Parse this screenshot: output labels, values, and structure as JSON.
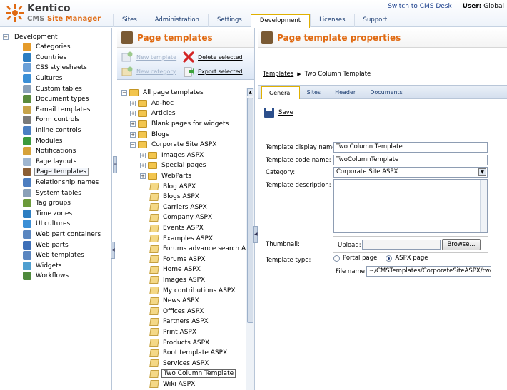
{
  "logo": {
    "brand": "Kentico",
    "product_cms": "CMS",
    "product_rest": "Site Manager"
  },
  "top_links": {
    "switch": "Switch to CMS Desk",
    "user_label": "User:",
    "user_value": "Global"
  },
  "main_tabs": [
    "Sites",
    "Administration",
    "Settings",
    "Development",
    "Licenses",
    "Support"
  ],
  "active_tab": "Development",
  "left_tree": {
    "root": "Development",
    "items": [
      {
        "label": "Categories",
        "icon": "categories-icon",
        "color": "#e59b2a"
      },
      {
        "label": "Countries",
        "icon": "globe-icon",
        "color": "#2d7ec2"
      },
      {
        "label": "CSS stylesheets",
        "icon": "css-icon",
        "color": "#6aa0d8"
      },
      {
        "label": "Cultures",
        "icon": "globe-icon",
        "color": "#3b8fd6"
      },
      {
        "label": "Custom tables",
        "icon": "table-icon",
        "color": "#8aa0b8"
      },
      {
        "label": "Document types",
        "icon": "document-types-icon",
        "color": "#5a8b3c"
      },
      {
        "label": "E-mail templates",
        "icon": "email-icon",
        "color": "#c7a44a"
      },
      {
        "label": "Form controls",
        "icon": "form-controls-icon",
        "color": "#7a7a7a"
      },
      {
        "label": "Inline controls",
        "icon": "inline-controls-icon",
        "color": "#4b7fc2"
      },
      {
        "label": "Modules",
        "icon": "modules-icon",
        "color": "#3c9a3c"
      },
      {
        "label": "Notifications",
        "icon": "notifications-icon",
        "color": "#d6a23a"
      },
      {
        "label": "Page layouts",
        "icon": "page-layouts-icon",
        "color": "#9fb6d0"
      },
      {
        "label": "Page templates",
        "icon": "page-templates-icon",
        "color": "#8b5e34",
        "selected": true
      },
      {
        "label": "Relationship names",
        "icon": "relationship-icon",
        "color": "#4c7dc0"
      },
      {
        "label": "System tables",
        "icon": "system-tables-icon",
        "color": "#8aa0b8"
      },
      {
        "label": "Tag groups",
        "icon": "tag-icon",
        "color": "#6b9a3a"
      },
      {
        "label": "Time zones",
        "icon": "clock-icon",
        "color": "#2d7ec2"
      },
      {
        "label": "UI cultures",
        "icon": "globe-icon",
        "color": "#3b8fd6"
      },
      {
        "label": "Web part containers",
        "icon": "container-icon",
        "color": "#5a86c0"
      },
      {
        "label": "Web parts",
        "icon": "web-parts-icon",
        "color": "#3d6fb8"
      },
      {
        "label": "Web templates",
        "icon": "web-templates-icon",
        "color": "#5a86c0"
      },
      {
        "label": "Widgets",
        "icon": "widgets-icon",
        "color": "#4f9fd0"
      },
      {
        "label": "Workflows",
        "icon": "workflow-icon",
        "color": "#4f8a3c"
      }
    ]
  },
  "middle": {
    "title": "Page templates",
    "actions": {
      "new_template": "New template",
      "new_category": "New category",
      "delete_selected": "Delete selected",
      "export_selected": "Export selected"
    },
    "tree_root": "All page templates",
    "level1": [
      "Ad-hoc",
      "Articles",
      "Blank pages for widgets",
      "Blogs"
    ],
    "open_category": "Corporate Site ASPX",
    "subcategories": [
      "Images ASPX",
      "Special pages",
      "WebParts"
    ],
    "templates": [
      "Blog ASPX",
      "Blogs ASPX",
      "Carriers ASPX",
      "Company ASPX",
      "Events ASPX",
      "Examples ASPX",
      "Forums advance search ASPX",
      "Forums ASPX",
      "Home ASPX",
      "Images ASPX",
      "My contributions ASPX",
      "News ASPX",
      "Offices ASPX",
      "Partners ASPX",
      "Print ASPX",
      "Products ASPX",
      "Root template ASPX",
      "Services ASPX",
      "Two Column Template",
      "Wiki ASPX"
    ],
    "selected_template": "Two Column Template"
  },
  "right": {
    "title": "Page template properties",
    "breadcrumb_link": "Templates",
    "breadcrumb_current": "Two Column Template",
    "subtabs": [
      "General",
      "Sites",
      "Header",
      "Documents"
    ],
    "active_subtab": "General",
    "save_label": "Save",
    "labels": {
      "display_name": "Template display name:",
      "code_name": "Template code name:",
      "category": "Category:",
      "description": "Template description:",
      "thumbnail": "Thumbnail:",
      "template_type": "Template type:",
      "upload": "Upload:",
      "file_name": "File name:"
    },
    "values": {
      "display_name": "Two Column Template",
      "code_name": "TwoColumnTemplate",
      "category": "Corporate Site ASPX",
      "browse": "Browse...",
      "portal_page": "Portal page",
      "aspx_page": "ASPX page",
      "file_name": "~/CMSTemplates/CorporateSiteASPX/two"
    }
  }
}
